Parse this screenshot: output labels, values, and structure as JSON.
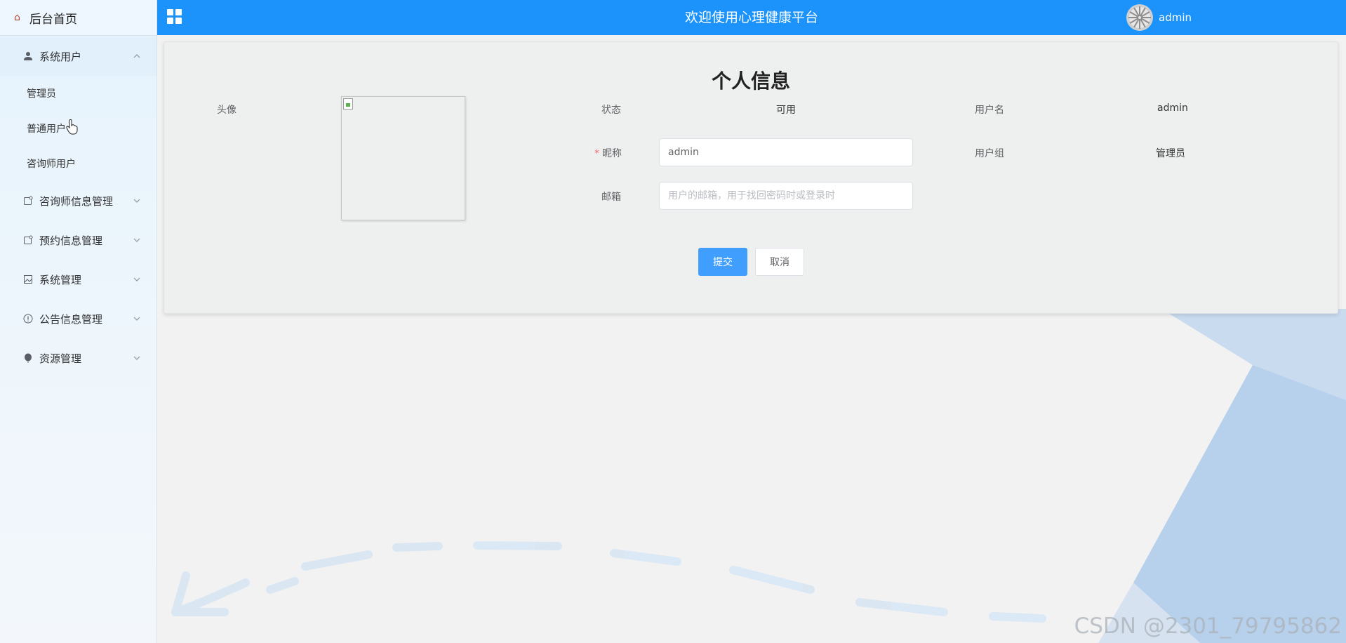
{
  "sidebar": {
    "home_label": "后台首页",
    "groups": [
      {
        "label": "系统用户",
        "icon": "user-icon",
        "expanded": true,
        "items": [
          {
            "label": "管理员"
          },
          {
            "label": "普通用户"
          },
          {
            "label": "咨询师用户"
          }
        ]
      },
      {
        "label": "咨询师信息管理",
        "icon": "doc-icon",
        "expanded": false
      },
      {
        "label": "预约信息管理",
        "icon": "doc-icon",
        "expanded": false
      },
      {
        "label": "系统管理",
        "icon": "picture-icon",
        "expanded": false
      },
      {
        "label": "公告信息管理",
        "icon": "info-circle-icon",
        "expanded": false
      },
      {
        "label": "资源管理",
        "icon": "balloon-icon",
        "expanded": false
      }
    ]
  },
  "header": {
    "title": "欢迎使用心理健康平台",
    "username": "admin",
    "background_color": "#1b93fb"
  },
  "profile": {
    "title": "个人信息",
    "avatar_label": "头像",
    "status_label": "状态",
    "status_value": "可用",
    "username_label": "用户名",
    "username_value": "admin",
    "nickname_label": "昵称",
    "nickname_value": "admin",
    "group_label": "用户组",
    "group_value": "管理员",
    "email_label": "邮箱",
    "email_placeholder": "用户的邮箱，用于找回密码时或登录时",
    "email_value": "",
    "submit_label": "提交",
    "cancel_label": "取消"
  },
  "watermark": "CSDN @2301_79795862",
  "colors": {
    "primary": "#409eff",
    "required": "#f56c6c"
  }
}
